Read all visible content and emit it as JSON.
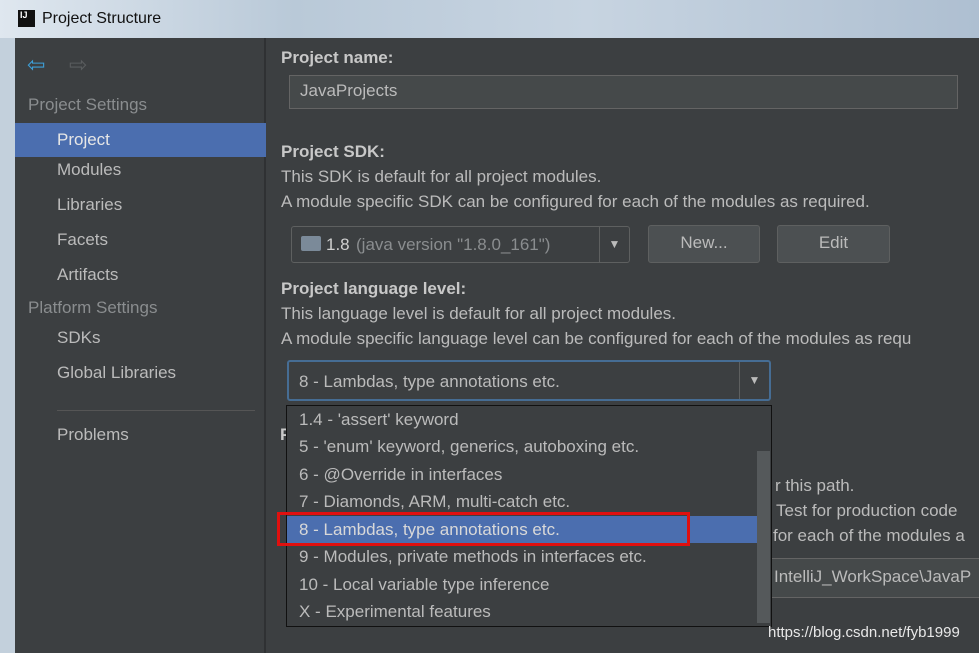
{
  "window": {
    "title": "Project Structure"
  },
  "sidebar": {
    "project_settings_label": "Project Settings",
    "project_items": [
      {
        "label": "Project",
        "selected": true
      },
      {
        "label": "Modules"
      },
      {
        "label": "Libraries"
      },
      {
        "label": "Facets"
      },
      {
        "label": "Artifacts"
      }
    ],
    "platform_settings_label": "Platform Settings",
    "platform_items": [
      {
        "label": "SDKs"
      },
      {
        "label": "Global Libraries"
      }
    ],
    "problems_label": "Problems"
  },
  "main": {
    "project_name_label": "Project name:",
    "project_name_value": "JavaProjects",
    "sdk_label": "Project SDK:",
    "sdk_desc1": "This SDK is default for all project modules.",
    "sdk_desc2": "A module specific SDK can be configured for each of the modules as required.",
    "sdk_version": "1.8",
    "sdk_detail": "(java version \"1.8.0_161\")",
    "new_button": "New...",
    "edit_button": "Edit",
    "lang_label": "Project language level:",
    "lang_desc1": "This language level is default for all project modules.",
    "lang_desc2": "A module specific language level can be configured for each of the modules as requ",
    "lang_selected": "8 - Lambdas, type annotations etc.",
    "obscured": {
      "line1": "r this path.",
      "line2": "Test for production code",
      "line3": "for each of the modules a",
      "path": "IntelliJ_WorkSpace\\JavaP"
    }
  },
  "dropdown": {
    "options": [
      {
        "label": "1.4 - 'assert' keyword"
      },
      {
        "label": "5 - 'enum' keyword, generics, autoboxing etc."
      },
      {
        "label": "6 - @Override in interfaces"
      },
      {
        "label": "7 - Diamonds, ARM, multi-catch etc."
      },
      {
        "label": "8 - Lambdas, type annotations etc.",
        "selected": true
      },
      {
        "label": "9 - Modules, private methods in interfaces etc."
      },
      {
        "label": "10 - Local variable type inference"
      },
      {
        "label": "X - Experimental features"
      }
    ]
  },
  "watermark": "https://blog.csdn.net/fyb1999",
  "colors": {
    "selection": "#4b6eaf",
    "highlight_box": "#e0100f",
    "back_arrow": "#3d9fd8"
  }
}
